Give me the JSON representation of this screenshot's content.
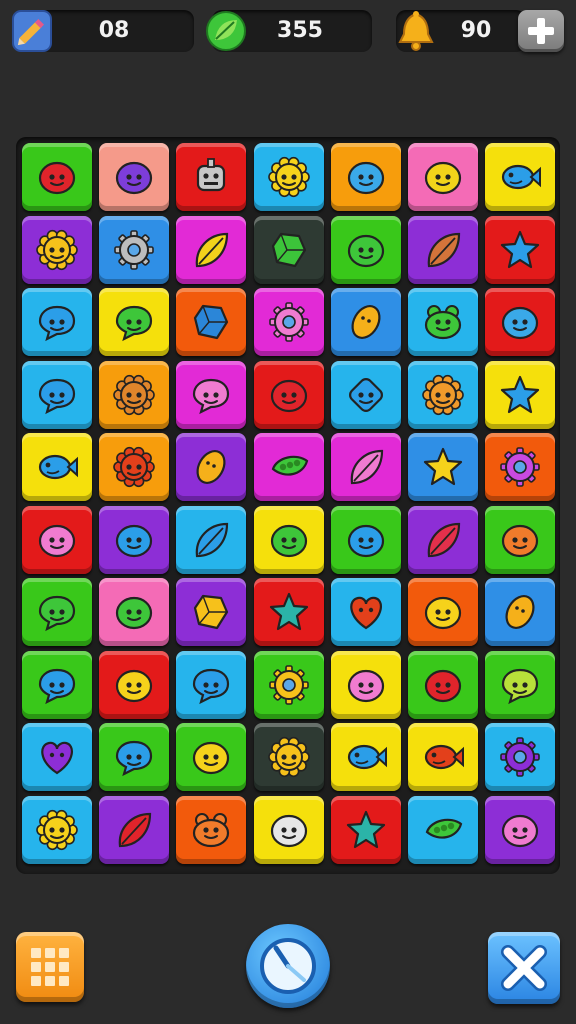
{
  "hud": {
    "pencil_count": "08",
    "leaf_count": "355",
    "bell_count": "90",
    "icons": [
      "pencil-icon",
      "leaf-icon",
      "bell-icon",
      "plus-icon"
    ]
  },
  "palette": {
    "G": "#39c81a",
    "S": "#f59a8a",
    "R": "#e31a1a",
    "C": "#26b4ec",
    "O": "#f79d0c",
    "P": "#f46bb6",
    "Y": "#f5e00c",
    "V": "#8d2ed6",
    "B": "#2f8fe6",
    "M": "#e22ad6",
    "K": "#2e3a33",
    "E": "#f25a0c"
  },
  "board": {
    "rows": [
      [
        {
          "c": "G",
          "i": "blob-face",
          "col": "#e0242b"
        },
        {
          "c": "S",
          "i": "blob-face",
          "col": "#7d3dd9"
        },
        {
          "c": "R",
          "i": "robot",
          "col": "#c8c8c8"
        },
        {
          "c": "C",
          "i": "sun",
          "col": "#f6d21b"
        },
        {
          "c": "O",
          "i": "blob-face",
          "col": "#3aa9e8"
        },
        {
          "c": "P",
          "i": "blob-face",
          "col": "#f2d31a"
        },
        {
          "c": "Y",
          "i": "fish",
          "col": "#2b9ee8"
        }
      ],
      [
        {
          "c": "V",
          "i": "sun",
          "col": "#f6c11b"
        },
        {
          "c": "B",
          "i": "gear",
          "col": "#bdbdbd"
        },
        {
          "c": "M",
          "i": "leaf-seed",
          "col": "#f2d21b"
        },
        {
          "c": "K",
          "i": "gem",
          "col": "#3cc43a"
        },
        {
          "c": "G",
          "i": "blob-face",
          "col": "#3ec63a"
        },
        {
          "c": "V",
          "i": "leaf-seed",
          "col": "#d4743a"
        },
        {
          "c": "R",
          "i": "star",
          "col": "#2b9ee8"
        }
      ],
      [
        {
          "c": "C",
          "i": "bubble",
          "col": "#2b9ee8"
        },
        {
          "c": "Y",
          "i": "bubble",
          "col": "#3ec63a"
        },
        {
          "c": "E",
          "i": "gem",
          "col": "#2b86d8"
        },
        {
          "c": "M",
          "i": "gear",
          "col": "#f07bd0"
        },
        {
          "c": "B",
          "i": "egg",
          "col": "#f5b01a"
        },
        {
          "c": "C",
          "i": "frog",
          "col": "#3ec63a"
        },
        {
          "c": "R",
          "i": "blob-face",
          "col": "#3aa9e8"
        }
      ],
      [
        {
          "c": "C",
          "i": "bubble",
          "col": "#2b9ee8"
        },
        {
          "c": "O",
          "i": "sun",
          "col": "#e0852b"
        },
        {
          "c": "M",
          "i": "bubble",
          "col": "#f07bd0"
        },
        {
          "c": "R",
          "i": "blob-face",
          "col": "#e0242b"
        },
        {
          "c": "C",
          "i": "diamond",
          "col": "#2b9ee8"
        },
        {
          "c": "C",
          "i": "sun",
          "col": "#f09a2b"
        },
        {
          "c": "Y",
          "i": "star",
          "col": "#2b9ee8"
        }
      ],
      [
        {
          "c": "Y",
          "i": "fish",
          "col": "#2b9ee8"
        },
        {
          "c": "O",
          "i": "sun",
          "col": "#e3401b"
        },
        {
          "c": "V",
          "i": "egg",
          "col": "#f5b01a"
        },
        {
          "c": "M",
          "i": "pod",
          "col": "#3ec63a"
        },
        {
          "c": "M",
          "i": "leaf-seed",
          "col": "#f07bd0"
        },
        {
          "c": "B",
          "i": "star",
          "col": "#f6d21b"
        },
        {
          "c": "E",
          "i": "gear",
          "col": "#c94ae0"
        }
      ],
      [
        {
          "c": "R",
          "i": "blob-face",
          "col": "#f07bd0"
        },
        {
          "c": "V",
          "i": "blob-face",
          "col": "#2b9ee8"
        },
        {
          "c": "C",
          "i": "leaf-seed",
          "col": "#2b9ee8"
        },
        {
          "c": "Y",
          "i": "blob-face",
          "col": "#3ec63a"
        },
        {
          "c": "G",
          "i": "blob-face",
          "col": "#2b9ee8"
        },
        {
          "c": "V",
          "i": "leaf-seed",
          "col": "#e3304b"
        },
        {
          "c": "G",
          "i": "blob-face",
          "col": "#f07b2b"
        }
      ],
      [
        {
          "c": "G",
          "i": "bubble",
          "col": "#3ec63a"
        },
        {
          "c": "P",
          "i": "blob-face",
          "col": "#3ec63a"
        },
        {
          "c": "V",
          "i": "gem",
          "col": "#f6c11b"
        },
        {
          "c": "R",
          "i": "star",
          "col": "#2bb4a8"
        },
        {
          "c": "C",
          "i": "heart",
          "col": "#e3401b"
        },
        {
          "c": "E",
          "i": "blob-face",
          "col": "#f6d21b"
        },
        {
          "c": "B",
          "i": "egg",
          "col": "#f5b01a"
        }
      ],
      [
        {
          "c": "G",
          "i": "bubble",
          "col": "#2b9ee8"
        },
        {
          "c": "R",
          "i": "blob-face",
          "col": "#f6d21b"
        },
        {
          "c": "C",
          "i": "bubble",
          "col": "#2b9ee8"
        },
        {
          "c": "G",
          "i": "gear",
          "col": "#f6c11b"
        },
        {
          "c": "Y",
          "i": "blob-face",
          "col": "#f07bd0"
        },
        {
          "c": "G",
          "i": "blob-face",
          "col": "#e0242b"
        },
        {
          "c": "G",
          "i": "bubble",
          "col": "#b8e03a"
        }
      ],
      [
        {
          "c": "C",
          "i": "heart",
          "col": "#8d2ed6"
        },
        {
          "c": "G",
          "i": "bubble",
          "col": "#2b9ee8"
        },
        {
          "c": "G",
          "i": "blob-face",
          "col": "#f6d21b"
        },
        {
          "c": "K",
          "i": "sun",
          "col": "#f6c11b"
        },
        {
          "c": "Y",
          "i": "fish",
          "col": "#2b9ee8"
        },
        {
          "c": "Y",
          "i": "fish",
          "col": "#e3401b"
        },
        {
          "c": "C",
          "i": "gear",
          "col": "#8d2ed6"
        }
      ],
      [
        {
          "c": "C",
          "i": "sun",
          "col": "#f6d21b"
        },
        {
          "c": "V",
          "i": "leaf-seed",
          "col": "#e0242b"
        },
        {
          "c": "E",
          "i": "frog",
          "col": "#f07b2b"
        },
        {
          "c": "Y",
          "i": "blob-face",
          "col": "#e6e6e6"
        },
        {
          "c": "R",
          "i": "star",
          "col": "#2bb4a8"
        },
        {
          "c": "C",
          "i": "pod",
          "col": "#3ec63a"
        },
        {
          "c": "V",
          "i": "blob-face",
          "col": "#f07bd0"
        }
      ]
    ]
  },
  "controls": {
    "icons": [
      "grid-icon",
      "rotate-icon",
      "close-icon"
    ]
  }
}
